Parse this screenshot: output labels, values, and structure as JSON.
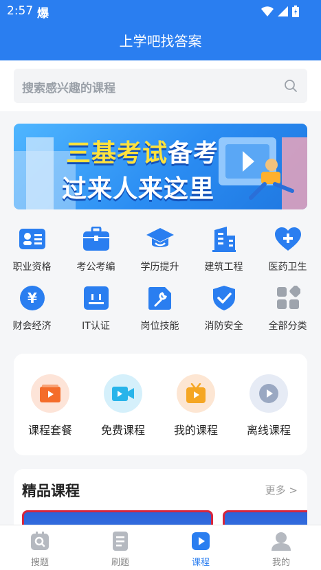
{
  "status": {
    "time": "2:57",
    "app_glyph": "爆"
  },
  "header": {
    "title": "上学吧找答案"
  },
  "search": {
    "placeholder": "搜索感兴趣的课程"
  },
  "banner": {
    "line1_a": "三基考试",
    "line1_b": "备考",
    "line2": "过来人来这里"
  },
  "categories": [
    {
      "label": "职业资格",
      "icon": "id-card-icon"
    },
    {
      "label": "考公考编",
      "icon": "briefcase-icon"
    },
    {
      "label": "学历提升",
      "icon": "graduation-cap-icon"
    },
    {
      "label": "建筑工程",
      "icon": "building-icon"
    },
    {
      "label": "医药卫生",
      "icon": "heart-plus-icon"
    },
    {
      "label": "财会经济",
      "icon": "yen-icon"
    },
    {
      "label": "IT认证",
      "icon": "monitor-icon"
    },
    {
      "label": "岗位技能",
      "icon": "wrench-icon"
    },
    {
      "label": "消防安全",
      "icon": "shield-icon"
    },
    {
      "label": "全部分类",
      "icon": "grid-icon"
    }
  ],
  "entries": [
    {
      "label": "课程套餐",
      "icon": "package-icon"
    },
    {
      "label": "免费课程",
      "icon": "video-camera-icon"
    },
    {
      "label": "我的课程",
      "icon": "tv-icon"
    },
    {
      "label": "离线课程",
      "icon": "play-circle-icon"
    }
  ],
  "featured": {
    "title": "精品课程",
    "more": "更多 >"
  },
  "tabs": [
    {
      "label": "搜题",
      "icon": "search-tab-icon",
      "active": false
    },
    {
      "label": "刷题",
      "icon": "document-icon",
      "active": false
    },
    {
      "label": "课程",
      "icon": "play-tab-icon",
      "active": true
    },
    {
      "label": "我的",
      "icon": "user-icon",
      "active": false
    }
  ],
  "colors": {
    "brand": "#2a7ef0",
    "accent_orange": "#f46c2a",
    "tab_inactive": "#888888"
  }
}
